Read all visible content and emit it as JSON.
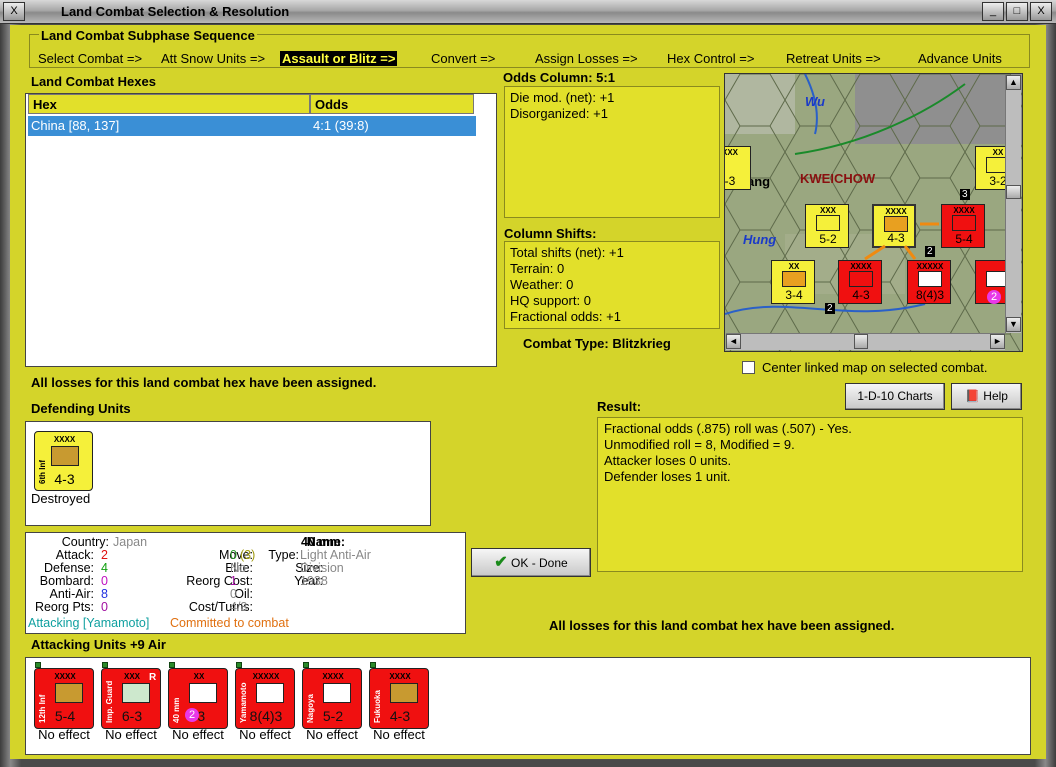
{
  "window": {
    "title": "Land Combat Selection & Resolution",
    "min_label": "_",
    "max_label": "□",
    "close_label": "X"
  },
  "sequence": {
    "title": "Land Combat Subphase Sequence",
    "steps": [
      "Select Combat =>",
      "Att Snow Units =>",
      "Assault or Blitz =>",
      "Convert =>",
      "Assign Losses =>",
      "Hex Control =>",
      "Retreat Units =>",
      "Advance Units"
    ],
    "active_index": 2
  },
  "combat_hexes": {
    "title": "Land Combat Hexes",
    "headers": [
      "Hex",
      "Odds"
    ],
    "rows": [
      {
        "hex": "China [88, 137]",
        "odds": "4:1 (39:8)"
      }
    ]
  },
  "odds": {
    "title": "Odds Column: 5:1",
    "lines": [
      "Die mod. (net): +1",
      "Disorganized: +1"
    ]
  },
  "shifts": {
    "title": "Column Shifts:",
    "lines": [
      "Total shifts (net): +1",
      "Terrain: 0",
      "Weather: 0",
      "HQ support: 0",
      "Fractional odds: +1"
    ]
  },
  "combat_type": "Combat Type:  Blitzkrieg",
  "map": {
    "labels": [
      "Wu",
      "KWEICHOW",
      "ang",
      "Hung"
    ],
    "units": [
      {
        "str": "5-2",
        "sz": "XXX",
        "color": "yel"
      },
      {
        "str": "4-3",
        "sz": "XXXX",
        "color": "yel"
      },
      {
        "str": "5-4",
        "sz": "XXXX",
        "color": "red"
      },
      {
        "str": "3-4",
        "sz": "XX",
        "color": "yel"
      },
      {
        "str": "4-3",
        "sz": "XXXX",
        "color": "red"
      },
      {
        "str": "8(4)3",
        "sz": "XXXXX",
        "color": "red"
      },
      {
        "str": "3-2",
        "sz": "XX",
        "color": "yel"
      },
      {
        "str": "-3",
        "sz": "XXX",
        "color": "yel"
      }
    ],
    "stack_counts": [
      "3",
      "2",
      "2"
    ],
    "overlay_badge": "2"
  },
  "center_map": {
    "label": "Center linked map on selected combat.",
    "checked": false
  },
  "status_top": "All losses for this land combat hex have been assigned.",
  "charts_button": "1-D-10 Charts",
  "help_button": "Help",
  "defending": {
    "title": "Defending Units",
    "units": [
      {
        "name": "6th Inf",
        "sz": "XXXX",
        "str": "4-3",
        "caption": "Destroyed"
      }
    ]
  },
  "result": {
    "title": "Result:",
    "lines": [
      "Fractional odds (.875) roll was (.507)  - Yes.",
      "Unmodified roll = 8, Modified = 9.",
      "Attacker loses 0 units.",
      "Defender loses 1 unit."
    ]
  },
  "unit_info": {
    "country_k": "Country:",
    "country_v": "Japan",
    "attack_k": "Attack:",
    "attack_v": "2",
    "defense_k": "Defense:",
    "defense_v": "4",
    "bombard_k": "Bombard:",
    "bombard_v": "0",
    "antiair_k": "Anti-Air:",
    "antiair_v": "8",
    "reorgpts_k": "Reorg Pts:",
    "reorgpts_v": "0",
    "name_k": "Name:",
    "name_v": "40 mm",
    "move_k": "Move:",
    "move_v": "0",
    "move_extra": "(3)",
    "elite_k": "Elite:",
    "elite_v": "No",
    "reorgcost_k": "Reorg Cost:",
    "reorgcost_v": "1",
    "oil_k": "Oil:",
    "oil_v": "0",
    "costturns_k": "Cost/Turns:",
    "costturns_v": "4/3",
    "type_k": "Type:",
    "type_v": "Light Anti-Air",
    "size_k": "Size:",
    "size_v": "Division",
    "year_k": "Year:",
    "year_v": "1938",
    "status_a": "Attacking [Yamamoto]",
    "status_b": "Committed to combat"
  },
  "ok_button": "OK - Done",
  "status_bottom": "All losses for this land combat hex have been assigned.",
  "attacking": {
    "title": "Attacking Units +9 Air",
    "units": [
      {
        "name": "12th Inf",
        "sz": "XXXX",
        "str": "5-4",
        "caption": "No effect",
        "badge": ""
      },
      {
        "name": "Imp. Guard",
        "sz": "XXX",
        "str": "6-3",
        "caption": "No effect",
        "badge": "R"
      },
      {
        "name": "40 mm",
        "sz": "XX",
        "str": "-3",
        "caption": "No effect",
        "badge": "2"
      },
      {
        "name": "Yamamoto",
        "sz": "XXXXX",
        "str": "8(4)3",
        "caption": "No effect",
        "badge": ""
      },
      {
        "name": "Nagoya",
        "sz": "XXXX",
        "str": "5-2",
        "caption": "No effect",
        "badge": ""
      },
      {
        "name": "Fukuoka",
        "sz": "XXXX",
        "str": "4-3",
        "caption": "No effect",
        "badge": ""
      }
    ]
  }
}
